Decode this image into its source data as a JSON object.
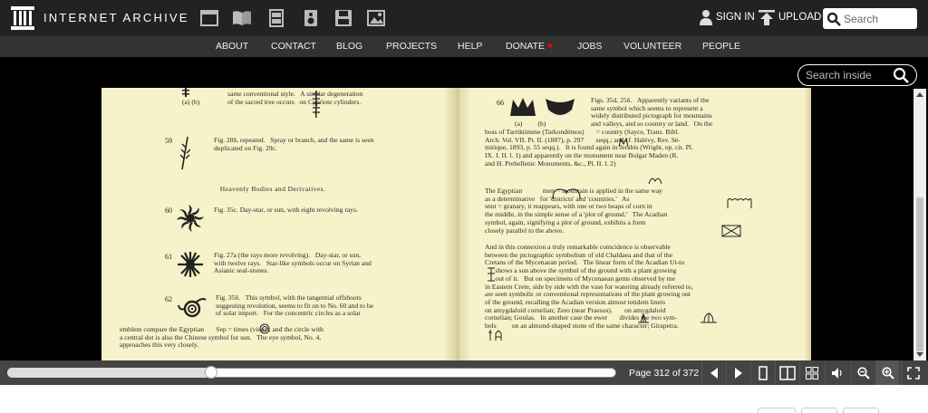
{
  "header": {
    "brand": "INTERNET ARCHIVE",
    "media_icons": [
      "web-icon",
      "texts-icon",
      "video-icon",
      "audio-icon",
      "software-icon",
      "images-icon"
    ],
    "sign_in": "SIGN IN",
    "upload": "UPLOAD",
    "search_placeholder": "Search"
  },
  "nav": {
    "items": [
      "ABOUT",
      "CONTACT",
      "BLOG",
      "PROJECTS",
      "HELP",
      "DONATE",
      "JOBS",
      "VOLUNTEER",
      "PEOPLE"
    ]
  },
  "viewer": {
    "search_inside_placeholder": "Search inside",
    "left_page": {
      "top_text": "same conventional style.   A similar degeneration\nof the sacred tree occurs   on Cypriote cylinders.",
      "top_labels": "(a)      (b)",
      "entry59_num": "59",
      "entry59_text": "Fig. 28δ, repeated.   Spray or branch, and the same is seen\nduplicated on Fig. 29c.",
      "section_heading": "Heavenly Bodies and Derivatives.",
      "entry60_num": "60",
      "entry60_text": "Fig. 35c.   Day-star, or sun, with eight revolving rays.",
      "entry61_num": "61",
      "entry61_text": "Fig. 27a (the rays more revolving).   Day-star, or sun,\nwith twelve rays.   Star-like symbols occur on Syrian and\nAsianic seal-stones.",
      "entry62_num": "62",
      "entry62_text_a": "Fig. 35δ.   This symbol, with the tangential offshoots\nsuggesting revolution, seems to fit on to No. 60 and to be\nof solar import.   For the concentric circles as a solar",
      "entry62_text_b": "emblem compare the Egyptian       Sep = times (vices), and the circle with\na central dot is also the Chinese symbol for sun.   The eye symbol, No. 4,\napproaches this very closely."
    },
    "right_page": {
      "entry66_num": "66",
      "fig_labels": "(a)         (b)",
      "p1": "Figs. 35d, 25δ.   Apparently variants of the\nsame symbol which seems to represent a\nwidely distributed pictograph for mountains\nand valleys, and so country or land.   On the",
      "p2": "boss of Tarriktimme (Tarkondémos)       = country (Sayce, Trans. Bibl.\nArch. Vol. VII. Pt. II. (1887), p. 297       seqq.; and cf. Halévy, Rev. Sé-\nmitique, 1893, p. 55 seqq.).   It is found again in Jerabis (Wright, op. cit. Pl.\nIX. J. II. l. 1) and apparently on the monument near Bulgar Maden (R.\nand H. Prehellenic Monuments, &c., Pl. II. l. 2)",
      "p3": "The Egyptian            men = mountain is applied in the same way\nas a determinative   for 'districts' and 'countries.'   As\nsnut = granary, it reappears, with one or two heaps of corn in\nthe middle, in the simple sense of a 'plot of ground.'   The Acadian\nsymbol, again, signifying a plot of ground, exhibits a form\nclosely parallel to the above.",
      "p4": "And in this connexion a truly remarkable coincidence is observable\nbetween the pictographic symbolism of old Chaldaea and that of the\nCretans of the Mycenaean period.   The linear form of the Acadian Ut-tu\n      shows a sun above the symbol of the ground with a plant growing\n      out of it.   But on specimens of Mycenaean gems observed by me\nin Eastern Crete, side by side with the vase for watering already referred to,\nare seen symbolic or conventional representations of the plant growing out\nof the ground, recalling the Acadian version almost totidem lineis\non amygdaloid cornelian; Zero (near Praesos).       on amygdaloid\ncornelian; Goulas.   In another case the ewer       divides the two sym-\nbols         on an almond-shaped stone of the same character; Girapetra."
    }
  },
  "controls": {
    "page_indicator": "Page 312 of 372",
    "progress": 0.335,
    "buttons": [
      "flip-left-icon",
      "flip-right-icon",
      "one-page-icon",
      "two-page-icon",
      "thumbnails-icon",
      "read-aloud-icon",
      "zoom-out-icon",
      "zoom-in-icon",
      "fullscreen-icon"
    ]
  }
}
